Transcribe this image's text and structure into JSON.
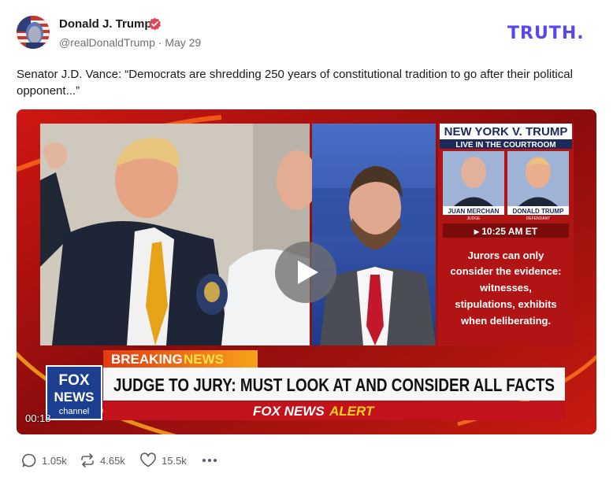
{
  "author": {
    "display_name": "Donald J. Trump",
    "handle": "@realDonaldTrump",
    "date": "May 29",
    "verified": true
  },
  "brand": {
    "logo_text": "TRUTH.",
    "color": "#5448ee"
  },
  "post": {
    "text": "Senator J.D. Vance: “Democrats are shredding 250 years of constitutional tradition to go after their political opponent...”"
  },
  "video": {
    "duration": "00:18",
    "broadcast": {
      "panel_title": "NEW YORK V. TRUMP",
      "panel_subtitle": "LIVE IN THE COURTROOM",
      "person1_name": "JUAN MERCHAN",
      "person1_role": "JUDGE",
      "person2_name": "DONALD TRUMP",
      "person2_role": "DEFENDANT",
      "time": "▸ 10:25 AM ET",
      "note_lines": [
        "Jurors can only",
        "consider the evidence:",
        "witnesses,",
        "stipulations, exhibits",
        "when deliberating."
      ],
      "breaking_label": "BREAKING",
      "breaking_news": "NEWS",
      "headline": "JUDGE TO JURY: MUST LOOK AT AND CONSIDER ALL FACTS",
      "alert_prefix": "FOX NEWS",
      "alert_word": "ALERT",
      "logo_top": "FOX",
      "logo_bottom": "NEWS",
      "logo_channel": "channel"
    }
  },
  "actions": {
    "replies": "1.05k",
    "retruths": "4.65k",
    "likes": "15.5k"
  },
  "icons": [
    "reply-icon",
    "retruth-icon",
    "heart-icon",
    "more-icon",
    "verified-icon",
    "play-icon"
  ]
}
